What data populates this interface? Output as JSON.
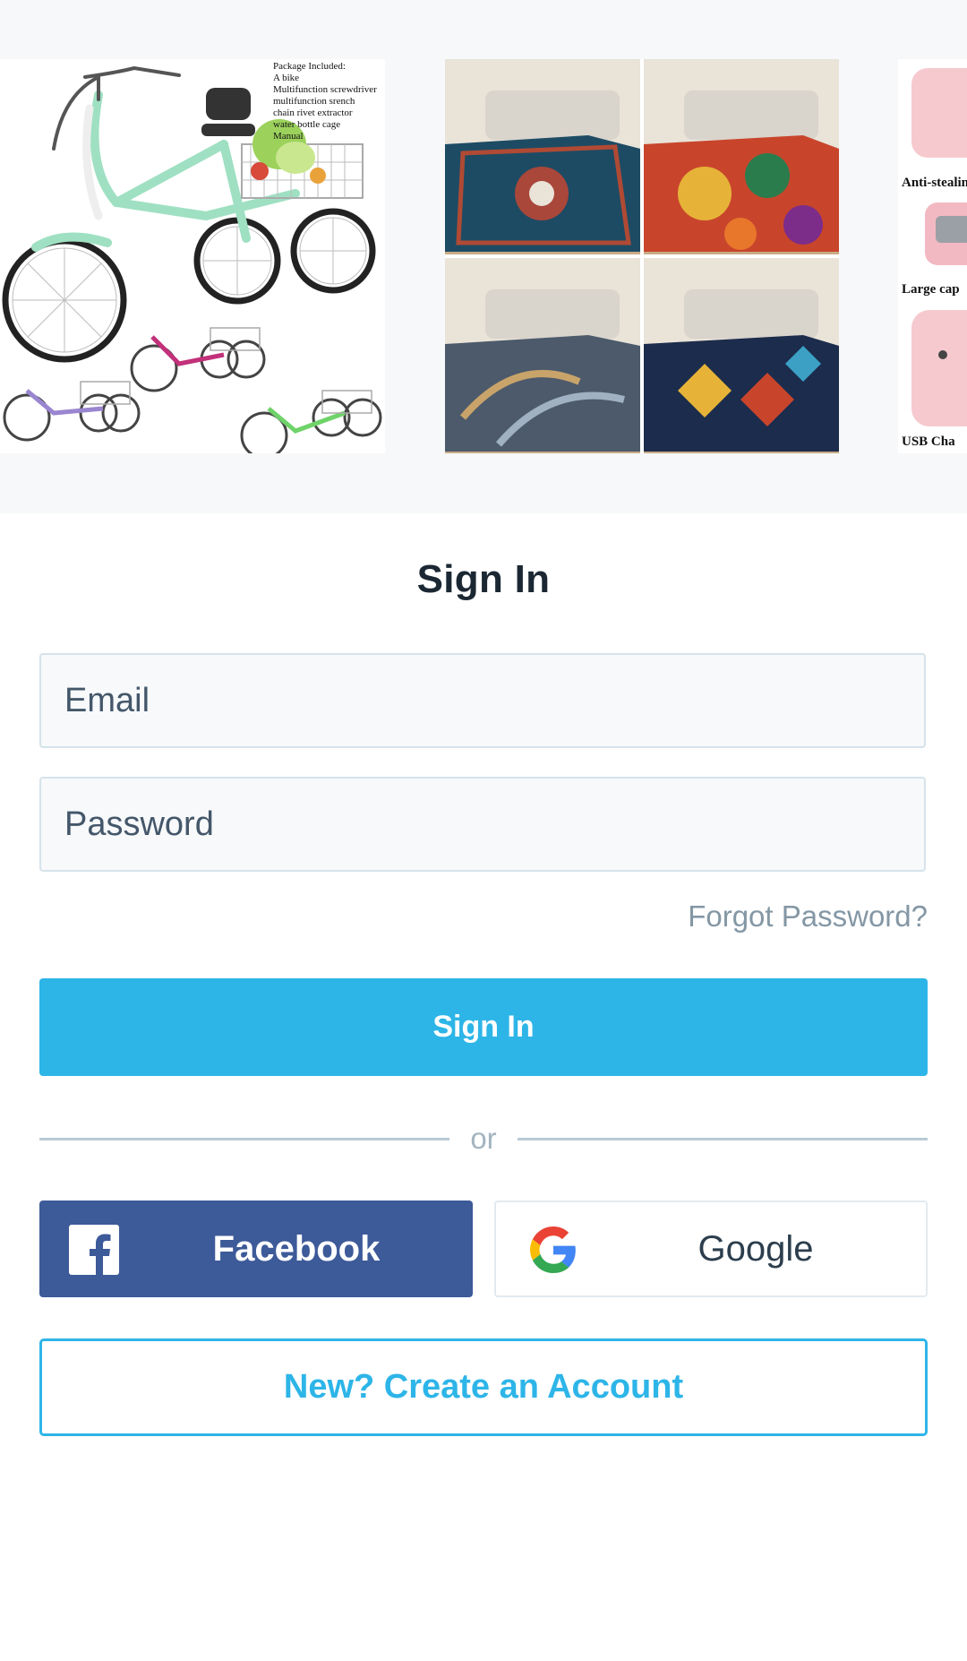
{
  "carousel": {
    "products": [
      {
        "name": "adult-tricycle",
        "package_text": "Package Included:\nA bike\nMultifunction  screwdriver\nmultifunction srench\nchain rivet extractor\nwater bottle cage\nManual"
      },
      {
        "name": "area-rugs"
      },
      {
        "name": "pink-backpack",
        "captions": [
          "Anti-stealin",
          "Large cap",
          "USB Cha"
        ]
      }
    ]
  },
  "form": {
    "title": "Sign In",
    "email_placeholder": "Email",
    "password_placeholder": "Password",
    "forgot_password": "Forgot Password?",
    "signin_button": "Sign In",
    "divider_text": "or",
    "facebook_button": "Facebook",
    "google_button": "Google",
    "create_account_button": "New? Create an Account"
  },
  "colors": {
    "accent": "#2db5e8",
    "facebook": "#3d5a99",
    "field_border": "#d6e3eb",
    "muted_text": "#8497a5",
    "title_text": "#1b2833"
  },
  "icons": {
    "facebook": "facebook-icon",
    "google": "google-icon"
  }
}
